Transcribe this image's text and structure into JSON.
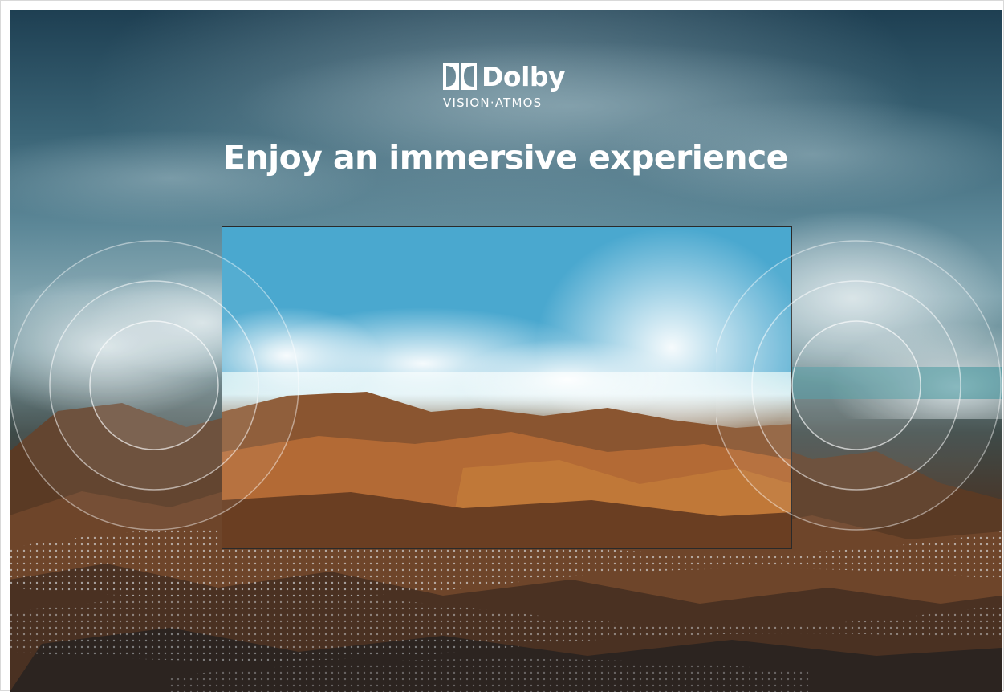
{
  "brand": {
    "name": "Dolby",
    "subtitle": "VISION·ATMOS"
  },
  "headline": "Enjoy an immersive experience",
  "colors": {
    "text": "#ffffff",
    "sky_dark": "#1e3f52",
    "sea": "#3fa0c8",
    "rock": "#b06a38"
  },
  "icons": {
    "logo_mark": "dolby-double-d-icon",
    "sound_waves": "sound-wave-rings-icon"
  }
}
